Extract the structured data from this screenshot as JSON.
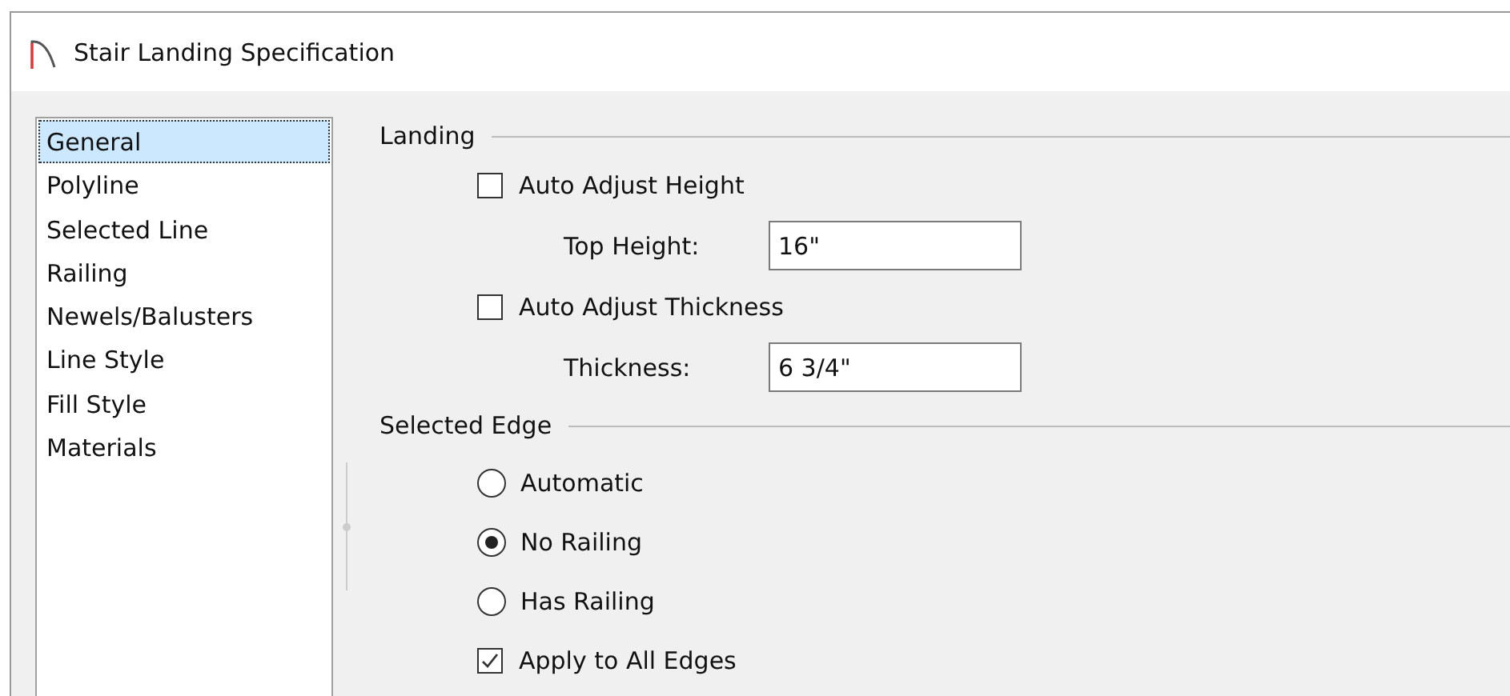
{
  "window": {
    "title": "Stair Landing Specification"
  },
  "sidebar": {
    "items": [
      {
        "label": "General",
        "selected": true
      },
      {
        "label": "Polyline",
        "selected": false
      },
      {
        "label": "Selected Line",
        "selected": false
      },
      {
        "label": "Railing",
        "selected": false
      },
      {
        "label": "Newels/Balusters",
        "selected": false
      },
      {
        "label": "Line Style",
        "selected": false
      },
      {
        "label": "Fill Style",
        "selected": false
      },
      {
        "label": "Materials",
        "selected": false
      }
    ]
  },
  "sections": [
    {
      "title": "Landing",
      "controls": [
        {
          "kind": "checkbox",
          "label": "Auto Adjust Height",
          "checked": false
        },
        {
          "kind": "field",
          "label": "Top Height:",
          "value": "16\""
        },
        {
          "kind": "checkbox",
          "label": "Auto Adjust Thickness",
          "checked": false
        },
        {
          "kind": "field",
          "label": "Thickness:",
          "value": "6 3/4\""
        }
      ]
    },
    {
      "title": "Selected Edge",
      "controls": [
        {
          "kind": "radio",
          "label": "Automatic",
          "selected": false
        },
        {
          "kind": "radio",
          "label": "No Railing",
          "selected": true
        },
        {
          "kind": "radio",
          "label": "Has Railing",
          "selected": false
        },
        {
          "kind": "checkbox",
          "label": "Apply to All Edges",
          "checked": true
        }
      ]
    }
  ]
}
